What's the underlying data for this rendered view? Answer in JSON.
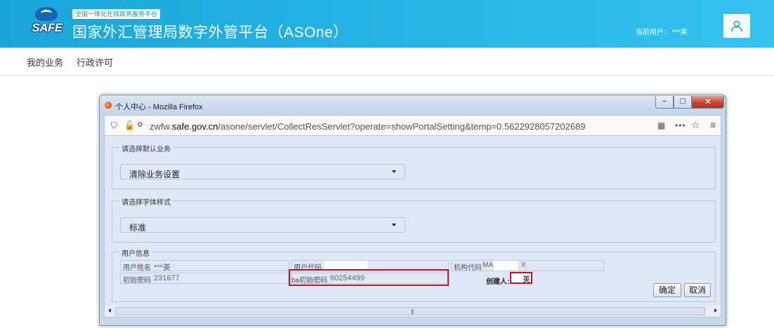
{
  "portal": {
    "logo_text": "SAFE",
    "subtitle_tag": "全国一体化在线政务服务平台",
    "app_title": "国家外汇管理局数字外管平台（ASOne）",
    "current_user_label": "当前用户：",
    "current_user_value": "***美",
    "user_icon": "user-icon"
  },
  "nav": {
    "items": [
      {
        "label": "我的业务"
      },
      {
        "label": "行政许可"
      }
    ]
  },
  "browser": {
    "window_title": "个人中心 - Mozilla Firefox",
    "url_prefix": "zwfw.",
    "url_domain": "safe.gov.cn",
    "url_path": "/asone/servlet/CollectResServlet?operate=showPortalSetting&temp=0.5622928057202689",
    "window_controls": [
      "minimize",
      "maximize",
      "close"
    ]
  },
  "form": {
    "default_business": {
      "legend": "请选择默认业务",
      "selected": "清除业务设置"
    },
    "font_style": {
      "legend": "请选择字体样式",
      "selected": "标准"
    },
    "user_info": {
      "legend": "用户信息",
      "user_name_label": "用户姓名",
      "user_name_value": "***美",
      "user_code_label": "用户代码",
      "org_code_label": "机构代码",
      "org_code_prefix": "MA",
      "org_code_suffix": "X",
      "init_pwd_label": "初始密码",
      "init_pwd_value": "231677",
      "ba_init_pwd_label": "ba初始密码",
      "ba_init_pwd_value": "60254499",
      "creator_label": "创建人:",
      "creator_value": "美"
    },
    "buttons": {
      "confirm": "确定",
      "cancel": "取消"
    }
  },
  "colors": {
    "header_blue": "#23b3e4",
    "highlight_red": "#d0101c",
    "form_bg": "#dfe8f6"
  }
}
